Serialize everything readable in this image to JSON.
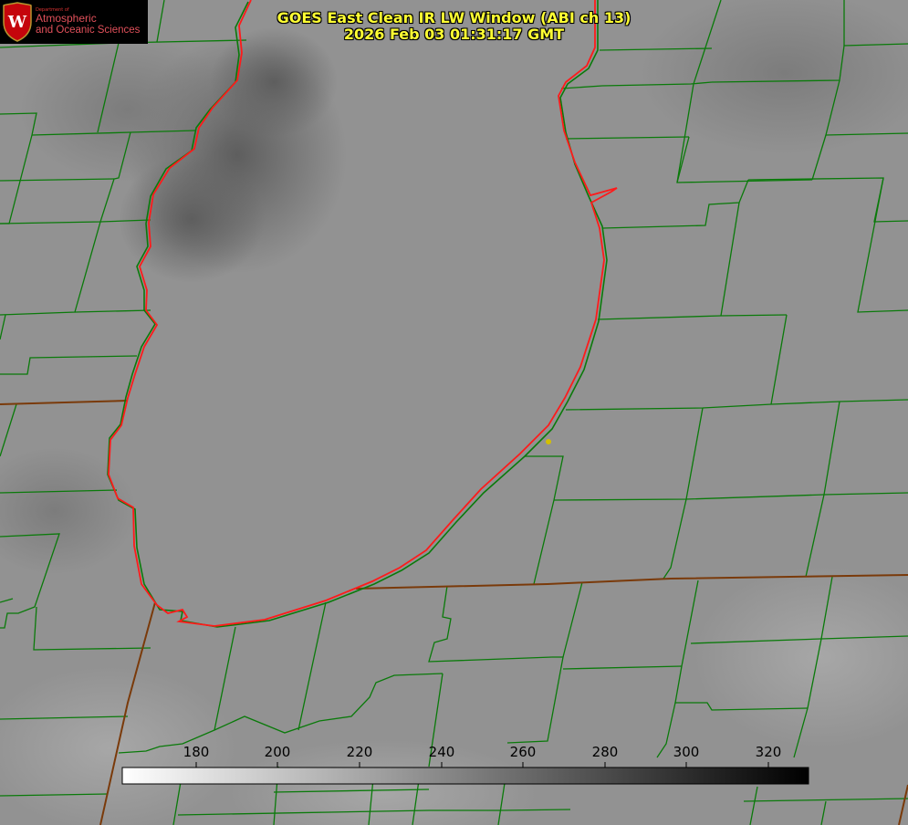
{
  "logo": {
    "department": "Department of",
    "line1": "Atmospheric",
    "line2": "and Oceanic Sciences",
    "crest_letter": "W",
    "crest_color": "#c5050c"
  },
  "title": {
    "line1": "GOES East Clean IR LW Window (ABI ch 13)",
    "line2": "2026 Feb 03 01:31:17 GMT"
  },
  "colorbar": {
    "ticks": [
      "180",
      "200",
      "220",
      "240",
      "260",
      "280",
      "300",
      "320"
    ],
    "gradient_from": "#ffffff",
    "gradient_to": "#000000"
  },
  "colors": {
    "county_lines": "#0a7a0a",
    "lake_outline": "#ff1a1a",
    "title_text": "#ffff33",
    "marker": "#d4c000"
  },
  "icons": {
    "uw_crest": "shield-crest-icon",
    "station_marker": "dot-marker-icon"
  }
}
